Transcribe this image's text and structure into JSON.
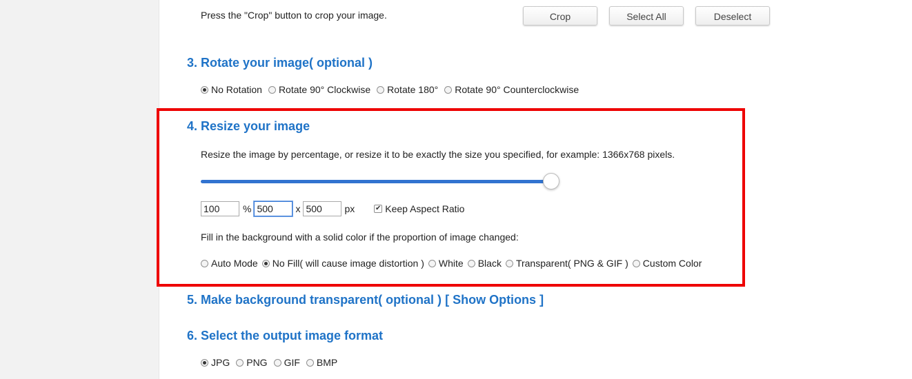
{
  "crop": {
    "hint": "Press the \"Crop\" button to crop your image.",
    "buttons": {
      "crop": "Crop",
      "select_all": "Select All",
      "deselect": "Deselect"
    }
  },
  "rotate": {
    "heading": "3. Rotate your image( optional )",
    "options": [
      "No Rotation",
      "Rotate 90° Clockwise",
      "Rotate 180°",
      "Rotate 90° Counterclockwise"
    ],
    "selected": "No Rotation"
  },
  "resize": {
    "heading": "4. Resize your image",
    "description": "Resize the image by percentage, or resize it to be exactly the size you specified, for example: 1366x768 pixels.",
    "slider_percent": 100,
    "percent_value": "100",
    "percent_unit": "%",
    "width_value": "500",
    "times": "x",
    "height_value": "500",
    "px_unit": "px",
    "keep_aspect_label": "Keep Aspect Ratio",
    "keep_aspect_checked": true,
    "fill_description": "Fill in the background with a solid color if the proportion of image changed:",
    "fill_options": [
      "Auto Mode",
      "No Fill( will cause image distortion )",
      "White",
      "Black",
      "Transparent( PNG & GIF )",
      "Custom Color"
    ],
    "fill_selected": "No Fill( will cause image distortion )",
    "highlight_color": "#ee0000"
  },
  "transparent": {
    "heading": "5. Make background transparent( optional )",
    "show_options": "[ Show Options ]"
  },
  "format": {
    "heading": "6. Select the output image format",
    "options": [
      "JPG",
      "PNG",
      "GIF",
      "BMP"
    ],
    "selected": "JPG"
  },
  "colors": {
    "heading": "#1f73c7",
    "slider": "#3173d0"
  }
}
